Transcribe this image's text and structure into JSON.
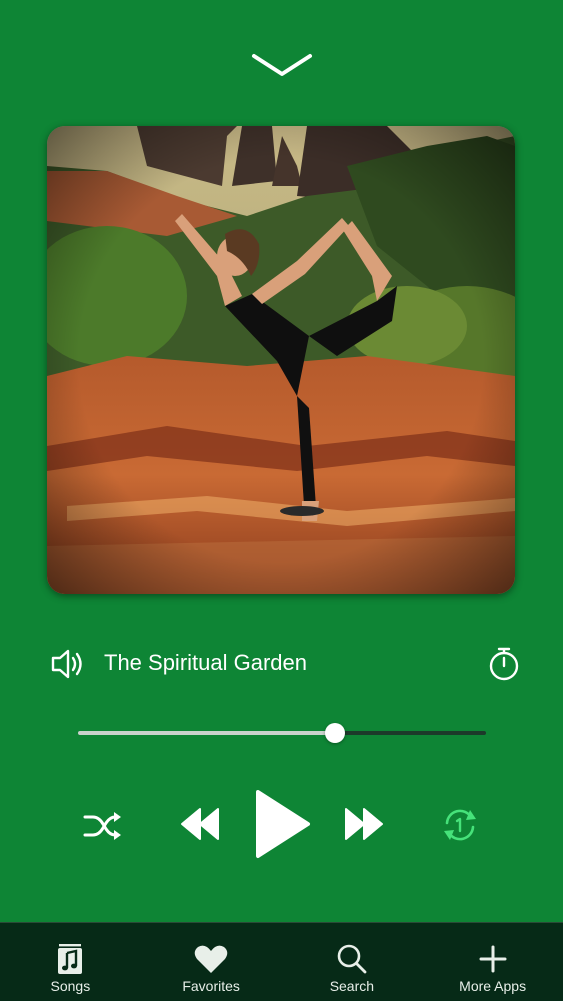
{
  "colors": {
    "background": "#0e8535",
    "tab_bar": "#062a17",
    "repeat_accent": "#46e27a",
    "slider_fill": "#c9d3cc",
    "slider_track": "#1c3a2a"
  },
  "header": {
    "collapse_icon": "chevron-down-icon"
  },
  "now_playing": {
    "title": "The Spiritual Garden",
    "volume_icon": "speaker-icon",
    "timer_icon": "stopwatch-icon",
    "artwork": "album-artwork"
  },
  "progress": {
    "fraction": 0.63
  },
  "controls": {
    "shuffle_icon": "shuffle-icon",
    "previous_icon": "rewind-icon",
    "play_icon": "play-icon",
    "next_icon": "fast-forward-icon",
    "repeat_icon": "repeat-one-icon"
  },
  "tab_bar": {
    "items": [
      {
        "label": "Songs",
        "icon": "music-note-icon"
      },
      {
        "label": "Favorites",
        "icon": "heart-icon"
      },
      {
        "label": "Search",
        "icon": "search-icon"
      },
      {
        "label": "More Apps",
        "icon": "plus-icon"
      }
    ]
  }
}
